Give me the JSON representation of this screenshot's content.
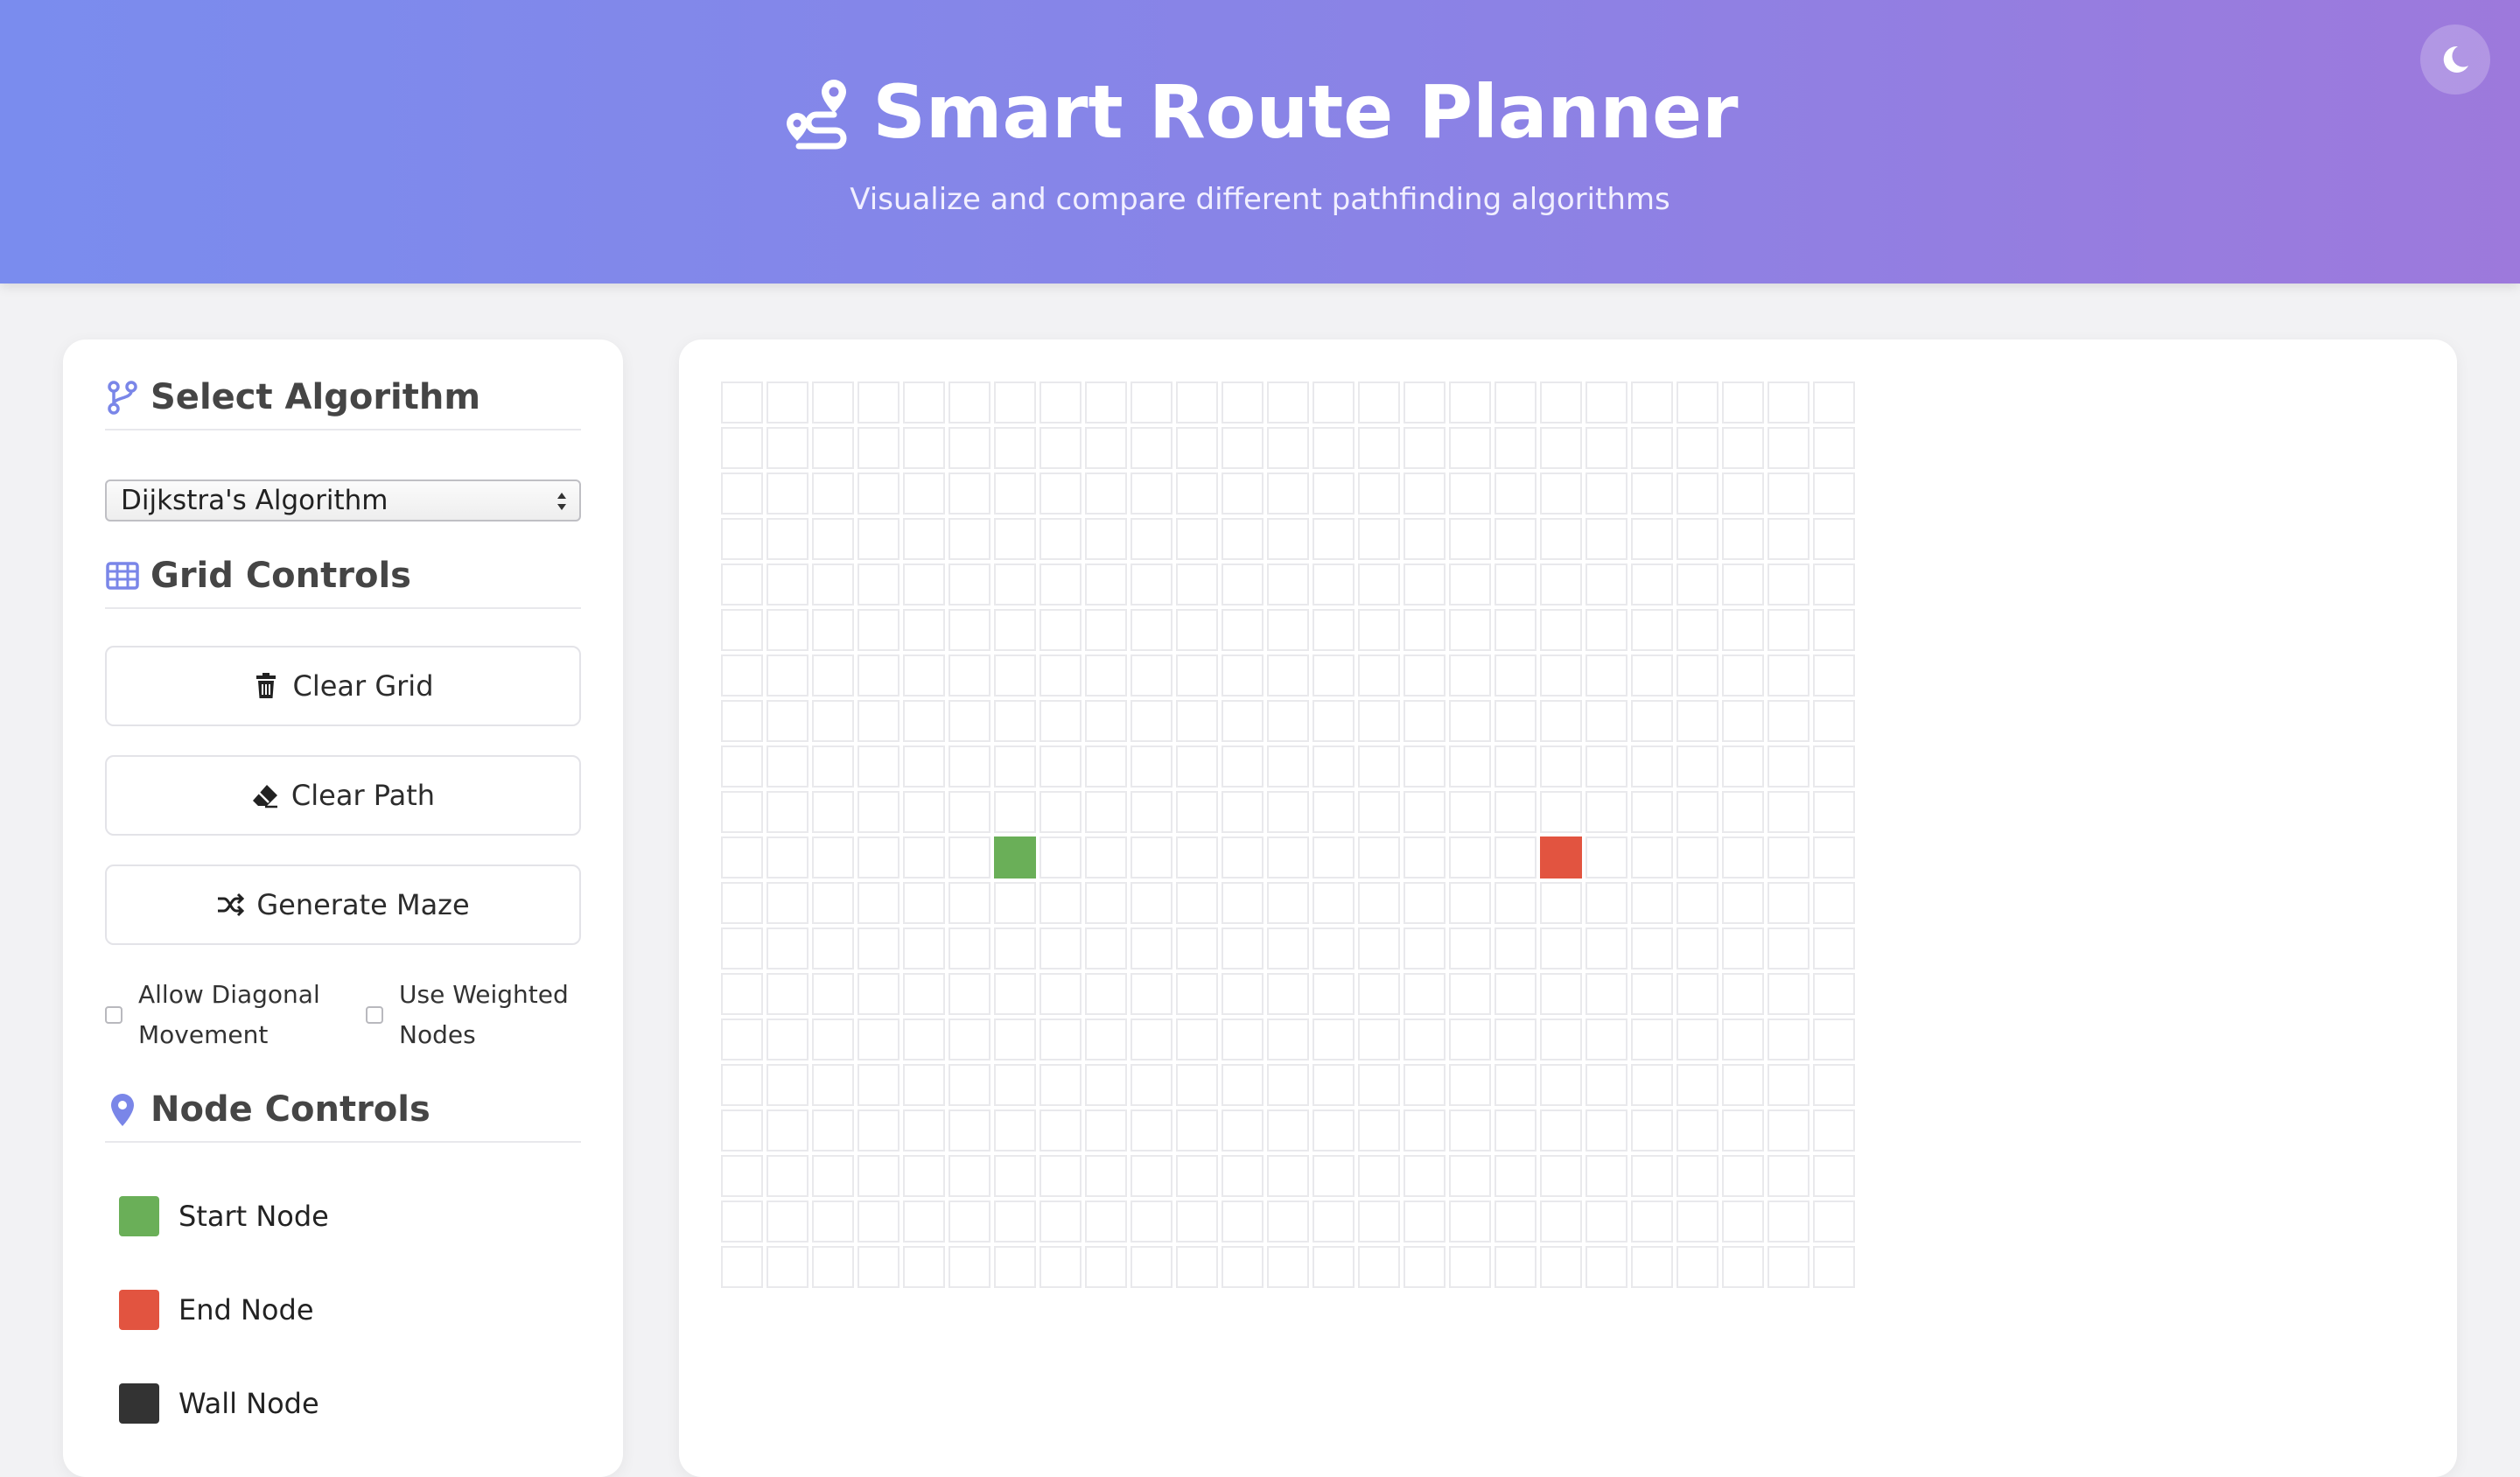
{
  "header": {
    "title": "Smart Route Planner",
    "subtitle": "Visualize and compare different pathfinding algorithms",
    "title_icon": "route-icon",
    "theme_toggle_icon": "moon-icon"
  },
  "sidebar": {
    "algorithm_section": {
      "title": "Select Algorithm",
      "icon": "code-branch-icon",
      "selected_algorithm": "Dijkstra's Algorithm"
    },
    "grid_controls": {
      "title": "Grid Controls",
      "icon": "table-icon",
      "clear_grid_label": "Clear Grid",
      "clear_path_label": "Clear Path",
      "generate_maze_label": "Generate Maze",
      "diagonal_label": "Allow Diagonal Movement",
      "diagonal_checked": false,
      "weighted_label": "Use Weighted Nodes",
      "weighted_checked": false
    },
    "node_controls": {
      "title": "Node Controls",
      "icon": "map-marker-icon",
      "legend": [
        {
          "label": "Start Node",
          "color": "#6aaf58"
        },
        {
          "label": "End Node",
          "color": "#e25440"
        },
        {
          "label": "Wall Node",
          "color": "#333333"
        }
      ]
    }
  },
  "grid": {
    "rows": 20,
    "cols": 25,
    "start": {
      "row": 10,
      "col": 6
    },
    "end": {
      "row": 10,
      "col": 18
    },
    "walls": []
  },
  "colors": {
    "accent": "#7a86e8",
    "start": "#6aaf58",
    "end": "#e25440",
    "wall": "#333333",
    "header_gradient": [
      "#7a8cee",
      "#9d79dc"
    ]
  }
}
